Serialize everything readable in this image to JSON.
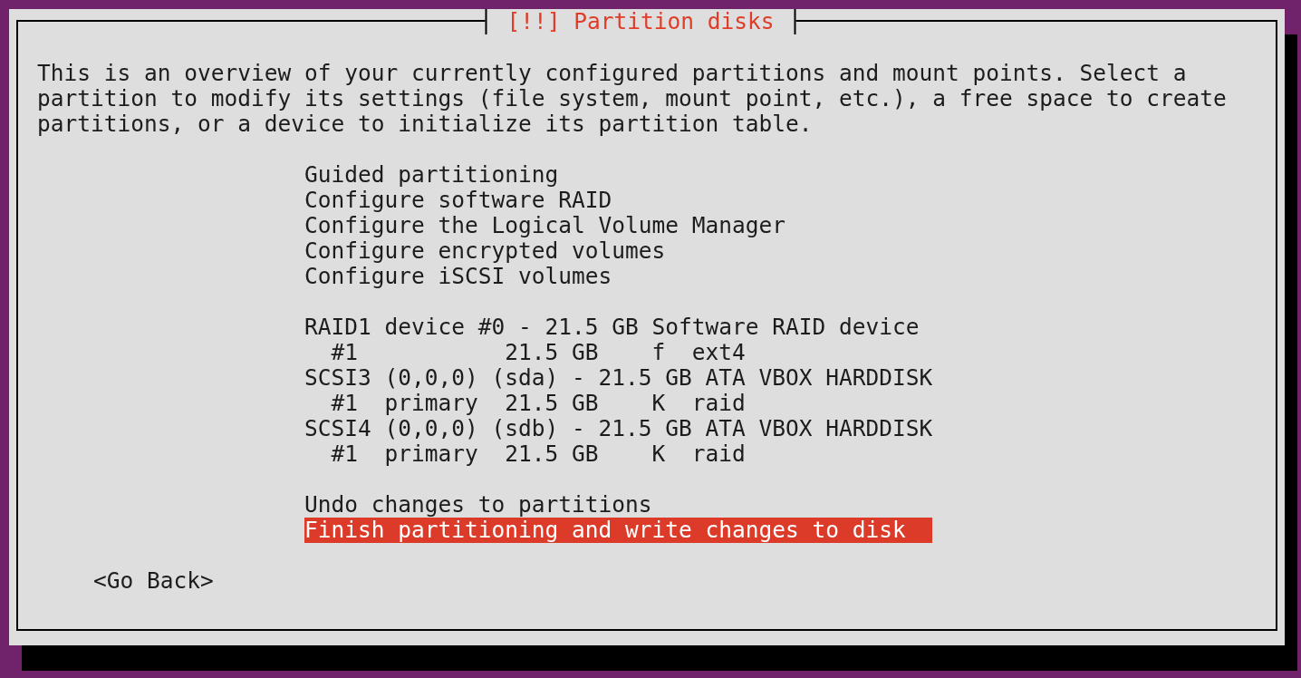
{
  "dialog": {
    "title": "[!!] Partition disks",
    "description": "This is an overview of your currently configured partitions and mount points. Select a partition to modify its settings (file system, mount point, etc.), a free space to create partitions, or a device to initialize its partition table.",
    "menu": {
      "sections": [
        {
          "items": [
            {
              "label": "Guided partitioning",
              "selected": false
            },
            {
              "label": "Configure software RAID",
              "selected": false
            },
            {
              "label": "Configure the Logical Volume Manager",
              "selected": false
            },
            {
              "label": "Configure encrypted volumes",
              "selected": false
            },
            {
              "label": "Configure iSCSI volumes",
              "selected": false
            }
          ]
        },
        {
          "items": [
            {
              "label": "RAID1 device #0 - 21.5 GB Software RAID device",
              "selected": false,
              "children": [
                {
                  "label": "#1           21.5 GB    f  ext4",
                  "selected": false
                }
              ]
            },
            {
              "label": "SCSI3 (0,0,0) (sda) - 21.5 GB ATA VBOX HARDDISK",
              "selected": false,
              "children": [
                {
                  "label": "#1  primary  21.5 GB    K  raid",
                  "selected": false
                }
              ]
            },
            {
              "label": "SCSI4 (0,0,0) (sdb) - 21.5 GB ATA VBOX HARDDISK",
              "selected": false,
              "children": [
                {
                  "label": "#1  primary  21.5 GB    K  raid",
                  "selected": false
                }
              ]
            }
          ]
        },
        {
          "items": [
            {
              "label": "Undo changes to partitions",
              "selected": false
            },
            {
              "label": "Finish partitioning and write changes to disk",
              "selected": true
            }
          ]
        }
      ]
    },
    "buttons": [
      {
        "label": "<Go Back>"
      }
    ]
  }
}
